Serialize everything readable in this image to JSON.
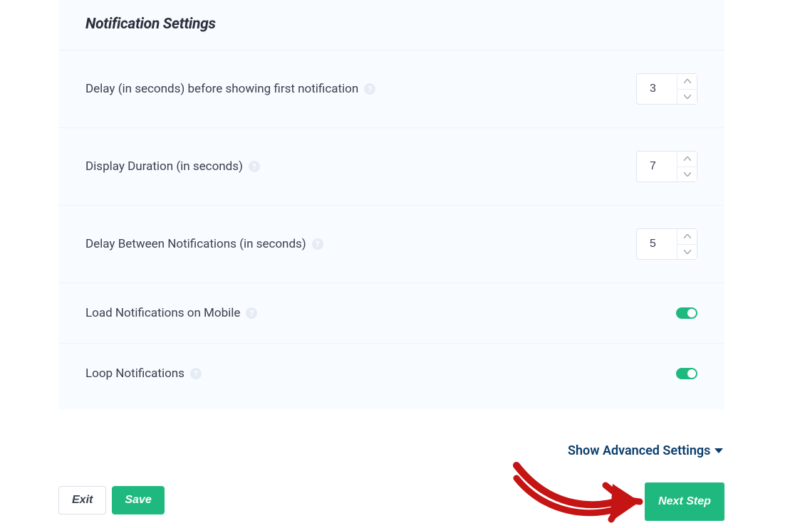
{
  "panel": {
    "title": "Notification Settings",
    "rows": [
      {
        "label": "Delay (in seconds) before showing first notification",
        "value": "3"
      },
      {
        "label": "Display Duration (in seconds)",
        "value": "7"
      },
      {
        "label": "Delay Between Notifications (in seconds)",
        "value": "5"
      },
      {
        "label": "Load Notifications on Mobile",
        "toggle": true
      },
      {
        "label": "Loop Notifications",
        "toggle": true
      }
    ]
  },
  "advanced_link": "Show Advanced Settings",
  "buttons": {
    "exit": "Exit",
    "save": "Save",
    "next_step": "Next Step"
  },
  "help_glyph": "?"
}
